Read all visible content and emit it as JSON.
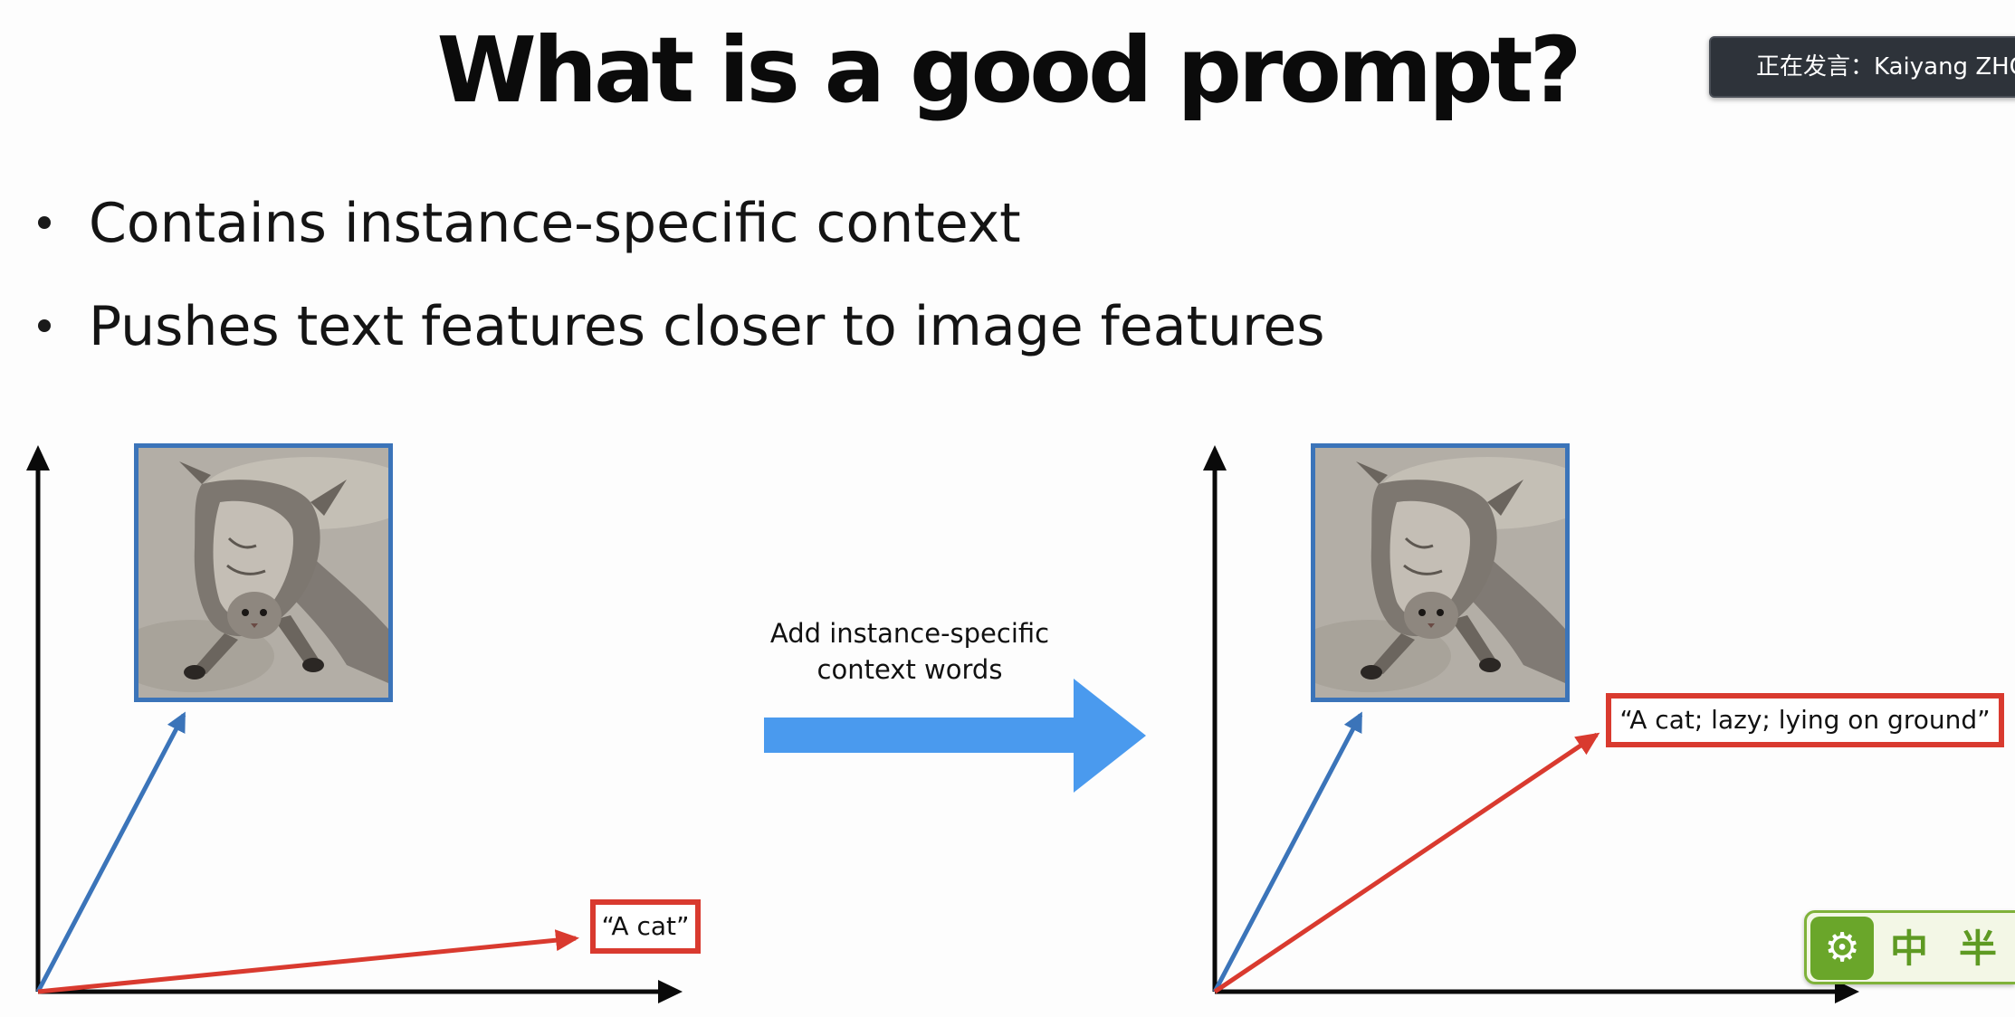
{
  "slide": {
    "title": "What is a good prompt?",
    "bullets": [
      "Contains instance-specific context",
      "Pushes text features closer to image features"
    ]
  },
  "speaker_banner": {
    "text": "正在发言：Kaiyang ZHOU"
  },
  "diagram": {
    "left_prompt": "“A cat”",
    "transform_label": "Add instance-specific context words",
    "right_prompt": "“A cat; lazy; lying on ground”"
  },
  "ime_toolbar": {
    "settings_icon": "gear-icon",
    "mode_label": "中",
    "width_label": "半"
  },
  "colors": {
    "image_feature": "#3b74b9",
    "text_feature": "#d93a2f",
    "transform_arrow": "#4a9aee",
    "ime_accent": "#6aa62a"
  }
}
